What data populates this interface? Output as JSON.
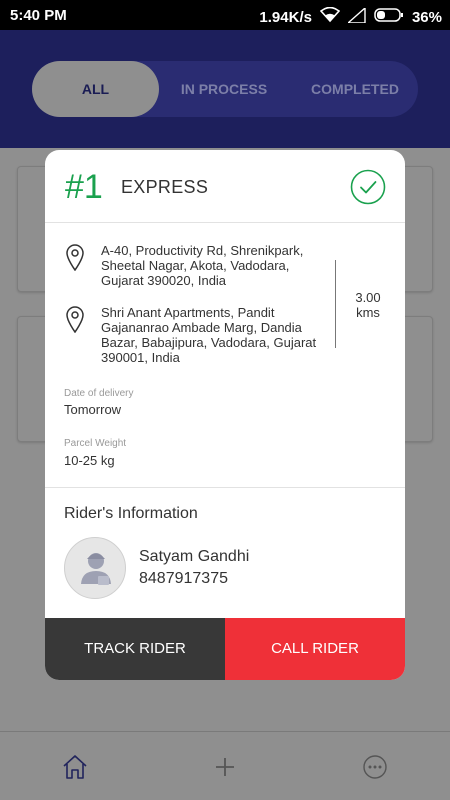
{
  "status_bar": {
    "time": "5:40 PM",
    "network_speed": "1.94K/s",
    "battery": "36%",
    "icons": [
      "wifi-icon",
      "signal-icon",
      "battery-icon"
    ]
  },
  "tabs": [
    {
      "label": "ALL",
      "active": true
    },
    {
      "label": "IN PROCESS",
      "active": false
    },
    {
      "label": "COMPLETED",
      "active": false
    }
  ],
  "order": {
    "number": "#1",
    "type": "EXPRESS",
    "status_icon": "check-circle-icon",
    "pickup_address": "A-40, Productivity Rd, Shrenikpark, Sheetal Nagar, Akota, Vadodara, Gujarat 390020, India",
    "drop_address": "Shri Anant Apartments, Pandit Gajananrao Ambade Marg, Dandia Bazar, Babajipura, Vadodara, Gujarat 390001, India",
    "distance_value": "3.00",
    "distance_unit": "kms",
    "delivery_label": "Date of delivery",
    "delivery_value": "Tomorrow",
    "weight_label": "Parcel Weight",
    "weight_value": "10-25 kg"
  },
  "rider": {
    "section_title": "Rider's Information",
    "name": "Satyam Gandhi",
    "phone": "8487917375"
  },
  "actions": {
    "track_label": "TRACK RIDER",
    "call_label": "CALL RIDER"
  },
  "colors": {
    "header": "#1d1f5c",
    "accent_green": "#1aa14e",
    "call_red": "#ef3038",
    "track_dark": "#383838"
  },
  "bottom_nav": [
    "home-icon",
    "add-icon",
    "more-icon"
  ]
}
